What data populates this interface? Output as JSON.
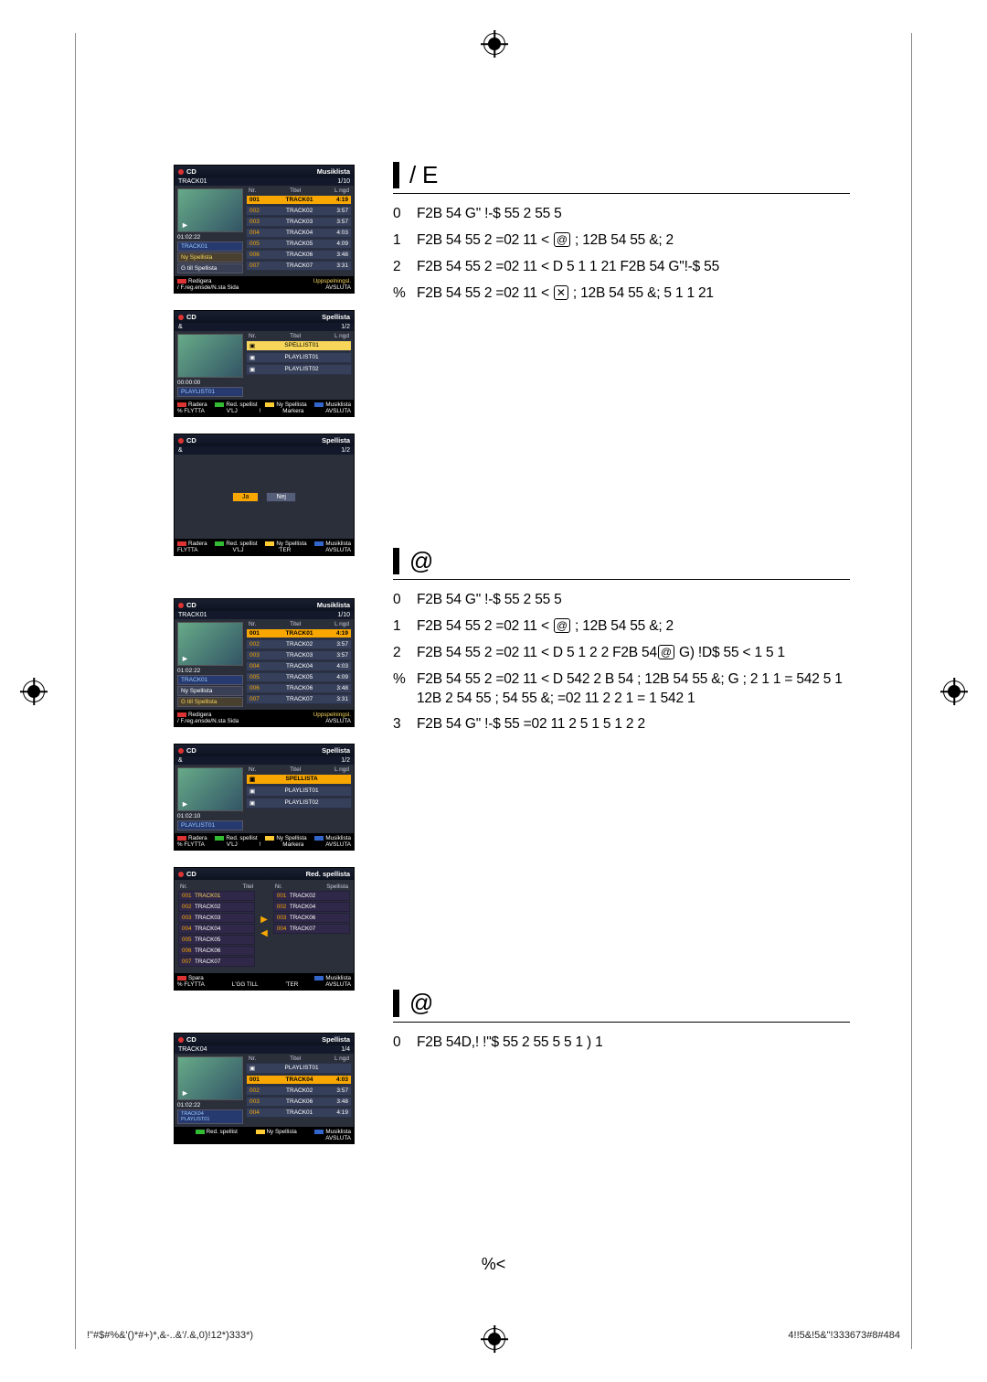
{
  "page_number": "%<",
  "footer_left": "!\"#$#%&'()*#+)*,&-..&'/.&,0)!12*)333*)",
  "footer_right": "4!!5&!5&\"!333673#8#484",
  "section1": {
    "title": "/ E",
    "steps": [
      {
        "n": "0",
        "t": "F2B  54 G\" !-$       55      2  55 5"
      },
      {
        "n": "1",
        "t": "F2B  54    55 2           =02  11  < @                     ; 12B         54        55         &;      2"
      },
      {
        "n": "2",
        "t": "F2B  54    55 2           =02  11  < D  5     1           1   21      F2B  54 G\"!-$       55"
      },
      {
        "n": "%",
        "t": "F2B  54    55 2           =02  11  < X   ; 12B        54   55           &;          5     1   1    21"
      }
    ]
  },
  "section2": {
    "title": "@",
    "steps": [
      {
        "n": "0",
        "t": "F2B  54 G\" !-$      55     2  55 5"
      },
      {
        "n": "1",
        "t": "F2B  54    55 2          =02  11  < @                    ; 12B        54       55        &;     2"
      },
      {
        "n": "2",
        "t": "F2B  54    55 2          =02  11  < D  5    1            2   2     F2B  54@ G) !D$   55    <  1 5     1"
      },
      {
        "n": "%",
        "t": "F2B  54   55 2            =02  11  < D  542         2            B    54        ; 12B         54  55          &;   G      ; 2   1 1   =   542   5    1 12B  2  54   55               ;       54   55         &; =02  11  2 2   1 =   1     542 1"
      },
      {
        "n": "3",
        "t": "F2B  54 G\" !-$      55 =02  11   2  5    1               5    1   2    2"
      }
    ]
  },
  "section3": {
    "title": "@",
    "steps": [
      {
        "n": "0",
        "t": "F2B  54D,! !\"$       55     2  55 5            5    1                )      1"
      }
    ]
  },
  "ui": {
    "cd": "CD",
    "musiklista": "Musiklista",
    "spellista": "Spellista",
    "red_spellista": "Red. spellista",
    "track01": "TRACK01",
    "track04": "TRACK04",
    "count_1_10": "1/10",
    "count_1_2": "1/2",
    "count_1_4": "1/4",
    "thead_nr": "Nr.",
    "thead_titel": "Titel",
    "thead_langd": "L ngd",
    "thead_spellista": "Spellista",
    "time": "01:02:22",
    "time2": "00:00:00",
    "time3": "01:02:10",
    "ny_spellista": "Ny Spellista",
    "g_till_spellista": "G  till Spellista",
    "radera": "Radera",
    "red_spellist": "Red. spellist",
    "musik": "Musiklista",
    "spara": "Spara",
    "uppspelningsl": "Uppspelningsl.",
    "redigera": "Redigera",
    "foreg": "F.reg.ensde/N.sta Sida",
    "avsluta": "AVSLUTA",
    "flytta": "FLYTTA",
    "pct_flytta": "% FLYTTA",
    "vlj": "V'LJ",
    "markera": "Markera",
    "l_gg_till": "L'GG TILL",
    "ter": "'TER",
    "ja": "Ja",
    "nej": "Nej",
    "playlist01": "PLAYLIST01",
    "playlist02": "PLAYLIST02",
    "spellist01": "SPELLIST01",
    "spellista_u": "SPELLISTA",
    "tracks_a": [
      {
        "n": "001",
        "t": "TRACK01",
        "d": "4:19"
      },
      {
        "n": "002",
        "t": "TRACK02",
        "d": "3:57"
      },
      {
        "n": "003",
        "t": "TRACK03",
        "d": "3:57"
      },
      {
        "n": "004",
        "t": "TRACK04",
        "d": "4:03"
      },
      {
        "n": "005",
        "t": "TRACK05",
        "d": "4:09"
      },
      {
        "n": "006",
        "t": "TRACK06",
        "d": "3:48"
      },
      {
        "n": "007",
        "t": "TRACK07",
        "d": "3:31"
      }
    ],
    "edit_left": [
      "TRACK01",
      "TRACK02",
      "TRACK03",
      "TRACK04",
      "TRACK05",
      "TRACK06",
      "TRACK07"
    ],
    "edit_right": [
      "TRACK02",
      "TRACK04",
      "TRACK06",
      "TRACK07"
    ],
    "s6_tracks": [
      {
        "n": "001",
        "t": "TRACK04",
        "d": "4:03"
      },
      {
        "n": "002",
        "t": "TRACK02",
        "d": "3:57"
      },
      {
        "n": "003",
        "t": "TRACK06",
        "d": "3:48"
      },
      {
        "n": "004",
        "t": "TRACK01",
        "d": "4:19"
      }
    ]
  }
}
